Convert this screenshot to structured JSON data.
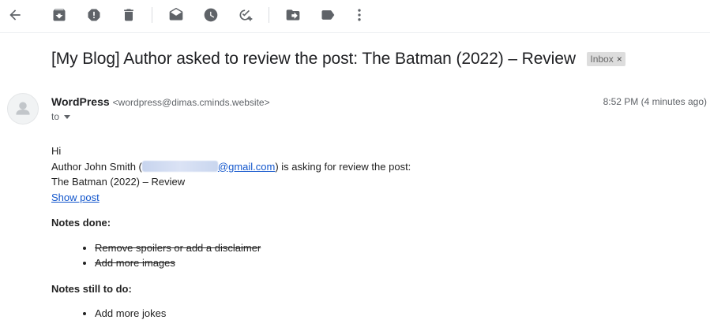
{
  "toolbar": {
    "icons": [
      "back-arrow-icon",
      "archive-icon",
      "report-spam-icon",
      "delete-icon",
      "mark-unread-icon",
      "snooze-icon",
      "add-to-tasks-icon",
      "move-to-icon",
      "labels-icon",
      "more-icon"
    ]
  },
  "subject": "[My Blog] Author asked to review the post: The Batman (2022) – Review",
  "label": {
    "text": "Inbox",
    "remove": "×"
  },
  "sender": {
    "name": "WordPress",
    "email": "<wordpress@dimas.cminds.website>",
    "to": "to",
    "time": "8:52 PM (4 minutes ago)"
  },
  "message": {
    "greeting": "Hi",
    "author_prefix": "Author John Smith (",
    "email_domain": "@gmail.com",
    "author_suffix": ") is asking for review the post:",
    "post_title": "The Batman (2022) – Review",
    "show_post": "Show post",
    "notes_done_heading": "Notes done:",
    "notes_done": [
      "Remove spoilers or add a disclaimer",
      "Add more images"
    ],
    "notes_todo_heading": "Notes still to do:",
    "notes_todo": [
      "Add more jokes"
    ]
  },
  "colors": {
    "link": "#1155cc",
    "icon": "#5f6368",
    "chip": "#dddddd"
  }
}
